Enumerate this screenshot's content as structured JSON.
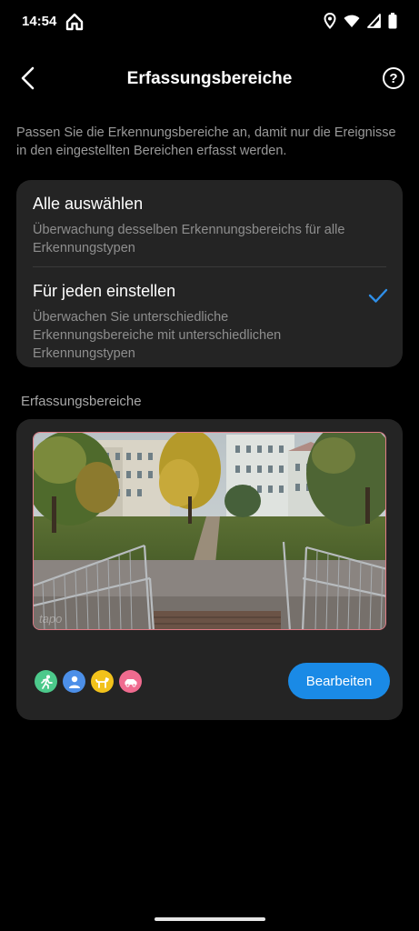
{
  "status_bar": {
    "time": "14:54"
  },
  "header": {
    "title": "Erfassungsbereiche"
  },
  "description": "Passen Sie die Erkennungsbereiche an, damit nur die Ereignisse in den eingestellten Bereichen erfasst werden.",
  "options": [
    {
      "title": "Alle auswählen",
      "subtitle": "Überwachung desselben Erkennungsbereichs für alle Erkennungstypen",
      "selected": false
    },
    {
      "title": "Für jeden einstellen",
      "subtitle": "Überwachen Sie unterschiedliche Erkennungsbereiche mit unterschiedlichen Erkennungstypen",
      "selected": true
    }
  ],
  "section": {
    "label": "Erfassungsbereiche",
    "watermark": "tapo",
    "edit_label": "Bearbeiten",
    "detection_types": [
      {
        "icon": "motion-icon",
        "color": "#4cc98b"
      },
      {
        "icon": "person-icon",
        "color": "#4c8fe8"
      },
      {
        "icon": "pet-icon",
        "color": "#f2c21b"
      },
      {
        "icon": "vehicle-icon",
        "color": "#f06b8f"
      }
    ]
  },
  "colors": {
    "accent": "#1a8ae6",
    "check": "#2f8fe8",
    "zone_border": "#e07b85"
  }
}
